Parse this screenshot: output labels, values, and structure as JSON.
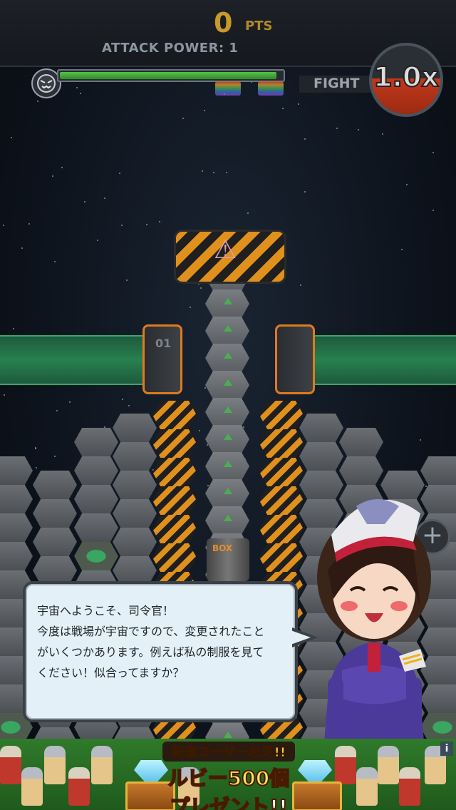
{
  "hud": {
    "score_value": "0",
    "score_unit": "PTS",
    "attack_power": "ATTACK POWER: 1",
    "fight_label": "FIGHT",
    "multiplier": "1.0x",
    "boss_hp_fraction": 0.98
  },
  "board": {
    "door_left_label": "01",
    "cannon_label": "BOX"
  },
  "dialog": {
    "lines": [
      "宇宙へようこそ、司令官！",
      "今度は戦場が宇宙ですので、変更されたこと",
      "がいくつかあります。例えば私の制服を見て",
      "ください！似合ってますか？"
    ]
  },
  "ad": {
    "line1": "新規ユーザー必見!!",
    "line2": "ルビー500個",
    "line3": "プレゼント!!",
    "info": "i"
  },
  "colors": {
    "accent_orange": "#e0901c",
    "hp_green": "#58c24a",
    "multiplier_red": "#c0391c"
  }
}
